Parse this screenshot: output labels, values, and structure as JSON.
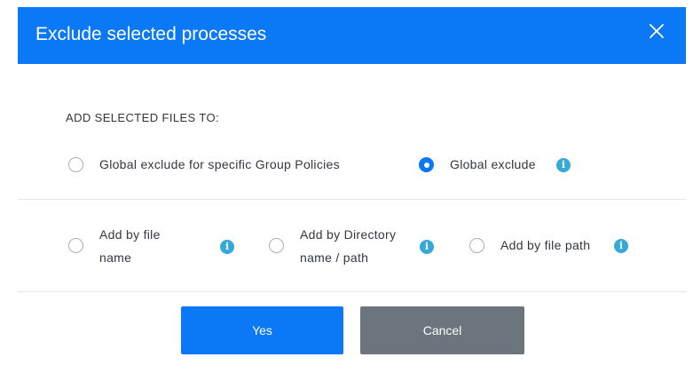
{
  "dialog": {
    "title": "Exclude selected processes",
    "close_icon": "close-icon"
  },
  "scope": {
    "section_label": "ADD SELECTED FILES TO:",
    "options": [
      {
        "label": "Global exclude for specific Group Policies",
        "selected": false
      },
      {
        "label": "Global exclude",
        "selected": true,
        "has_info": true
      }
    ]
  },
  "method": {
    "options": [
      {
        "label": "Add by file name",
        "selected": false,
        "has_info": true
      },
      {
        "label": "Add by Directory name / path",
        "selected": false,
        "has_info": true
      },
      {
        "label": "Add by file path",
        "selected": false,
        "has_info": true
      }
    ]
  },
  "buttons": {
    "yes_label": "Yes",
    "cancel_label": "Cancel"
  },
  "colors": {
    "primary": "#0b78f5",
    "secondary": "#6c757d",
    "info": "#36a9d9"
  },
  "info_glyph": "i"
}
